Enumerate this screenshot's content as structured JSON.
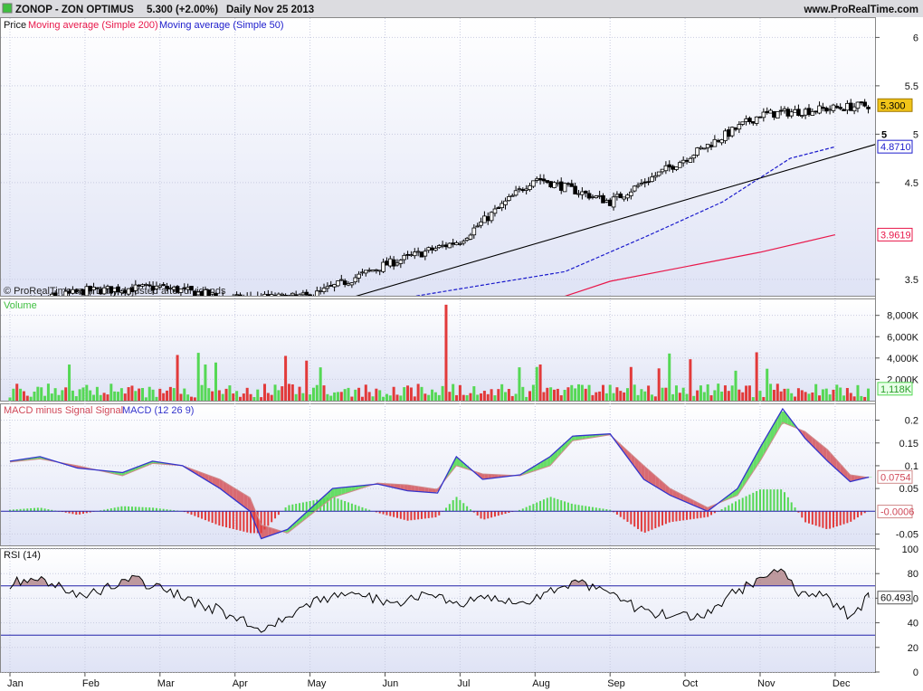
{
  "header": {
    "symbol": "ZONOP - ZON OPTIMUS",
    "quote": "5.300 (+2.00%)",
    "period_date": "Daily  Nov 25 2013",
    "website": "www.ProRealTime.com"
  },
  "colors": {
    "header_bg": "#dcdce0",
    "panel_bg_top": "#ffffff",
    "panel_bg_bottom": "#dfe3f5",
    "ma200": "#e8174a",
    "ma50": "#1b1bcc",
    "volume_up": "#55d855",
    "volume_down": "#e23a3a",
    "macd_line": "#3333cc",
    "signal_line": "#d08a8a",
    "fill_up": "#66dd66",
    "fill_down": "#d86a72",
    "rsi_line": "#000000",
    "rsi_over": "#8e4a50",
    "level_line": "#2222aa",
    "price_badge": "#f0c419"
  },
  "chart_data": [
    {
      "type": "candlestick",
      "panel": "price",
      "legend": [
        "Price",
        "Moving average (Simple 200)",
        "Moving average (Simple 50)"
      ],
      "watermark": "© ProRealTime.com  Daily adjusted after dividends",
      "y_ticks": [
        "6",
        "5.5",
        "5",
        "4.5",
        "3.5"
      ],
      "y_tick_values": [
        6,
        5.5,
        5,
        4.5,
        3.5
      ],
      "ylim": [
        3.33,
        6.2
      ],
      "badges": {
        "close": "5.300",
        "ma50": "4.8710",
        "ma200": "3.9619",
        "level": "5"
      },
      "badge_values": {
        "close": 5.3,
        "ma50": 4.871,
        "ma200": 3.9619,
        "level": 5.0
      },
      "monthly_close": [
        [
          "Jan",
          3.22
        ],
        [
          "Feb",
          3.38
        ],
        [
          "Mar",
          3.42
        ],
        [
          "Apr",
          3.3
        ],
        [
          "May",
          3.32
        ],
        [
          "Jun",
          3.65
        ],
        [
          "Jul",
          3.9
        ],
        [
          "Aug",
          4.55
        ],
        [
          "Sep",
          4.3
        ],
        [
          "Oct",
          4.75
        ],
        [
          "Nov",
          5.2
        ],
        [
          "Nov 25",
          5.3
        ]
      ],
      "ma50_path": [
        [
          5.2,
          3.3
        ],
        [
          7.4,
          3.58
        ],
        [
          8.5,
          3.95
        ],
        [
          9.5,
          4.3
        ],
        [
          10.4,
          4.75
        ],
        [
          11.0,
          4.87
        ]
      ],
      "ma200_path": [
        [
          7.3,
          3.3
        ],
        [
          8.0,
          3.48
        ],
        [
          10.0,
          3.78
        ],
        [
          11.0,
          3.96
        ]
      ],
      "trendline": [
        [
          4.5,
          3.3
        ],
        [
          12.0,
          5.0
        ]
      ]
    },
    {
      "type": "bar",
      "panel": "volume",
      "legend": [
        "Volume"
      ],
      "y_ticks": [
        "8,000K",
        "6,000K",
        "4,000K",
        "2,000K"
      ],
      "y_tick_values": [
        8000,
        6000,
        4000,
        2000
      ],
      "ylim": [
        0,
        9500
      ],
      "badge": "1,118K",
      "badge_value": 1118,
      "peak": {
        "month_index": 5.8,
        "value": 9000
      }
    },
    {
      "type": "line",
      "panel": "macd",
      "legend": [
        "MACD minus Signal Signal",
        "MACD (12 26 9)"
      ],
      "y_ticks": [
        "0.2",
        "0.15",
        "0.1",
        "0.05",
        "-0.05"
      ],
      "y_tick_values": [
        0.2,
        0.15,
        0.1,
        0.05,
        -0.05
      ],
      "ylim": [
        -0.075,
        0.235
      ],
      "badges": {
        "macd": "0.0754",
        "hist": "-0.0006"
      },
      "badge_values": {
        "macd": 0.0754,
        "hist": -0.0006
      },
      "macd_path": [
        [
          0.0,
          0.11
        ],
        [
          0.4,
          0.12
        ],
        [
          0.9,
          0.095
        ],
        [
          1.5,
          0.085
        ],
        [
          1.9,
          0.11
        ],
        [
          2.3,
          0.1
        ],
        [
          2.8,
          0.05
        ],
        [
          3.2,
          0.0
        ],
        [
          3.35,
          -0.06
        ],
        [
          3.7,
          -0.04
        ],
        [
          4.3,
          0.05
        ],
        [
          4.9,
          0.06
        ],
        [
          5.3,
          0.045
        ],
        [
          5.7,
          0.04
        ],
        [
          5.95,
          0.12
        ],
        [
          6.3,
          0.07
        ],
        [
          6.8,
          0.08
        ],
        [
          7.2,
          0.12
        ],
        [
          7.5,
          0.165
        ],
        [
          8.0,
          0.17
        ],
        [
          8.45,
          0.07
        ],
        [
          8.8,
          0.035
        ],
        [
          9.3,
          0.0
        ],
        [
          9.7,
          0.05
        ],
        [
          10.0,
          0.14
        ],
        [
          10.3,
          0.225
        ],
        [
          10.6,
          0.16
        ],
        [
          10.9,
          0.11
        ],
        [
          11.2,
          0.065
        ],
        [
          11.45,
          0.075
        ]
      ],
      "signal_path": [
        [
          0.0,
          0.108
        ],
        [
          0.4,
          0.115
        ],
        [
          0.9,
          0.1
        ],
        [
          1.5,
          0.078
        ],
        [
          1.9,
          0.105
        ],
        [
          2.3,
          0.1
        ],
        [
          2.8,
          0.07
        ],
        [
          3.2,
          0.03
        ],
        [
          3.35,
          -0.03
        ],
        [
          3.7,
          -0.048
        ],
        [
          4.3,
          0.03
        ],
        [
          4.9,
          0.062
        ],
        [
          5.3,
          0.058
        ],
        [
          5.7,
          0.048
        ],
        [
          5.95,
          0.1
        ],
        [
          6.3,
          0.082
        ],
        [
          6.8,
          0.078
        ],
        [
          7.2,
          0.1
        ],
        [
          7.5,
          0.155
        ],
        [
          8.0,
          0.168
        ],
        [
          8.45,
          0.1
        ],
        [
          8.8,
          0.05
        ],
        [
          9.3,
          0.008
        ],
        [
          9.7,
          0.035
        ],
        [
          10.0,
          0.11
        ],
        [
          10.3,
          0.195
        ],
        [
          10.6,
          0.175
        ],
        [
          10.9,
          0.135
        ],
        [
          11.2,
          0.08
        ],
        [
          11.45,
          0.074
        ]
      ]
    },
    {
      "type": "line",
      "panel": "rsi",
      "legend": [
        "RSI (14)"
      ],
      "y_ticks": [
        "100",
        "80",
        "60",
        "40",
        "20",
        "0"
      ],
      "y_tick_values": [
        100,
        80,
        60,
        40,
        20,
        0
      ],
      "ylim": [
        0,
        100
      ],
      "levels": [
        70,
        30
      ],
      "badge": "60.493",
      "badge_value": 60.493,
      "rsi_path": [
        [
          0.0,
          72
        ],
        [
          0.3,
          76
        ],
        [
          0.6,
          72
        ],
        [
          1.0,
          60
        ],
        [
          1.3,
          70
        ],
        [
          1.6,
          76
        ],
        [
          2.0,
          68
        ],
        [
          2.4,
          58
        ],
        [
          2.8,
          50
        ],
        [
          3.2,
          38
        ],
        [
          3.3,
          34
        ],
        [
          3.7,
          46
        ],
        [
          4.2,
          60
        ],
        [
          4.7,
          62
        ],
        [
          5.2,
          55
        ],
        [
          5.6,
          68
        ],
        [
          5.9,
          52
        ],
        [
          6.3,
          60
        ],
        [
          6.8,
          55
        ],
        [
          7.2,
          66
        ],
        [
          7.5,
          72
        ],
        [
          8.0,
          68
        ],
        [
          8.4,
          50
        ],
        [
          8.8,
          45
        ],
        [
          9.2,
          44
        ],
        [
          9.6,
          62
        ],
        [
          10.0,
          76
        ],
        [
          10.3,
          86
        ],
        [
          10.5,
          66
        ],
        [
          10.9,
          60
        ],
        [
          11.2,
          45
        ],
        [
          11.45,
          60.5
        ]
      ]
    }
  ],
  "x_axis": {
    "ticks": [
      "Jan",
      "Feb",
      "Mar",
      "Apr",
      "May",
      "Jun",
      "Jul",
      "Aug",
      "Sep",
      "Oct",
      "Nov",
      "Dec"
    ]
  }
}
